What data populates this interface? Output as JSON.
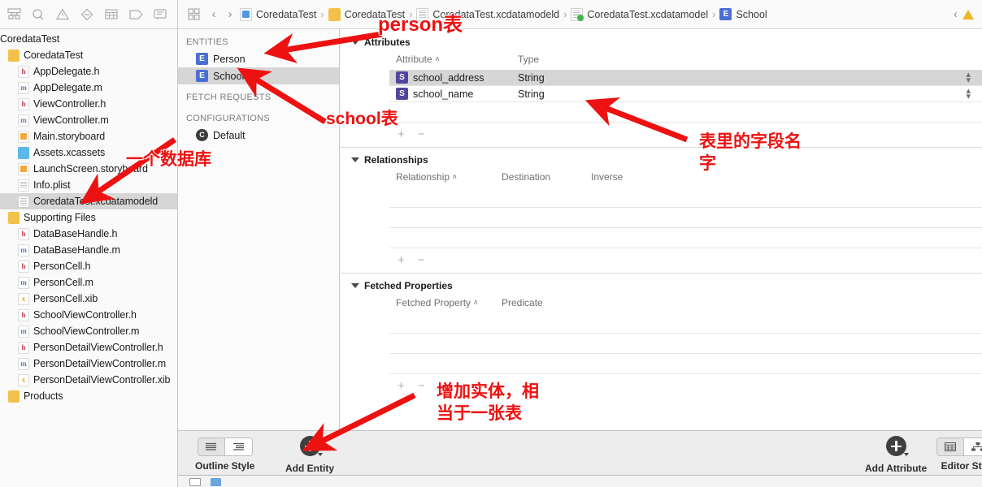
{
  "navigator": {
    "toolbar_icons": [
      "file-navigator-icon",
      "search-navigator-icon",
      "issue-navigator-icon",
      "test-navigator-icon",
      "debug-navigator-icon",
      "breakpoint-navigator-icon",
      "report-navigator-icon"
    ],
    "root": "CoredataTest",
    "items": [
      {
        "label": "CoredataTest",
        "kind": "folder",
        "level": 1
      },
      {
        "label": "AppDelegate.h",
        "kind": "h",
        "level": 2
      },
      {
        "label": "AppDelegate.m",
        "kind": "m",
        "level": 2
      },
      {
        "label": "ViewController.h",
        "kind": "h",
        "level": 2
      },
      {
        "label": "ViewController.m",
        "kind": "m",
        "level": 2
      },
      {
        "label": "Main.storyboard",
        "kind": "sb",
        "level": 2
      },
      {
        "label": "Assets.xcassets",
        "kind": "folder-blue",
        "level": 2
      },
      {
        "label": "LaunchScreen.storyboard",
        "kind": "sb",
        "level": 2
      },
      {
        "label": "Info.plist",
        "kind": "plist",
        "level": 2
      },
      {
        "label": "CoredataTest.xcdatamodeld",
        "kind": "model",
        "level": 2,
        "selected": true
      },
      {
        "label": "Supporting Files",
        "kind": "folder",
        "level": 1
      },
      {
        "label": "DataBaseHandle.h",
        "kind": "h",
        "level": 2
      },
      {
        "label": "DataBaseHandle.m",
        "kind": "m",
        "level": 2
      },
      {
        "label": "PersonCell.h",
        "kind": "h",
        "level": 2
      },
      {
        "label": "PersonCell.m",
        "kind": "m",
        "level": 2
      },
      {
        "label": "PersonCell.xib",
        "kind": "xib",
        "level": 2
      },
      {
        "label": "SchoolViewController.h",
        "kind": "h",
        "level": 2
      },
      {
        "label": "SchoolViewController.m",
        "kind": "m",
        "level": 2
      },
      {
        "label": "PersonDetailViewController.h",
        "kind": "h",
        "level": 2
      },
      {
        "label": "PersonDetailViewController.m",
        "kind": "m",
        "level": 2
      },
      {
        "label": "PersonDetailViewController.xib",
        "kind": "xib",
        "level": 2
      },
      {
        "label": "Products",
        "kind": "folder",
        "level": 1
      }
    ]
  },
  "jumpbar": {
    "back_label": "‹",
    "forward_label": "›",
    "crumbs": [
      {
        "label": "CoredataTest",
        "icon": "project-icon"
      },
      {
        "label": "CoredataTest",
        "icon": "folder-icon"
      },
      {
        "label": "CoredataTest.xcdatamodeld",
        "icon": "datamodeld-icon"
      },
      {
        "label": "CoredataTest.xcdatamodel",
        "icon": "datamodel-ok-icon"
      },
      {
        "label": "School",
        "icon": "entity-icon"
      }
    ],
    "separator": "›",
    "right_collapse": "‹"
  },
  "entity_sidebar": {
    "sections": [
      {
        "title": "ENTITIES",
        "items": [
          {
            "label": "Person",
            "badge": "E",
            "selected": false
          },
          {
            "label": "School",
            "badge": "E",
            "selected": true
          }
        ]
      },
      {
        "title": "FETCH REQUESTS",
        "items": []
      },
      {
        "title": "CONFIGURATIONS",
        "items": [
          {
            "label": "Default",
            "badge": "C",
            "selected": false
          }
        ]
      }
    ]
  },
  "editor": {
    "attributes": {
      "title": "Attributes",
      "columns": [
        "Attribute",
        "Type"
      ],
      "sort_indicator": "ʌ",
      "rows": [
        {
          "badge": "S",
          "name": "school_address",
          "type": "String",
          "selected": true
        },
        {
          "badge": "S",
          "name": "school_name",
          "type": "String",
          "selected": false
        }
      ],
      "add_label": "+",
      "remove_label": "−"
    },
    "relationships": {
      "title": "Relationships",
      "columns": [
        "Relationship",
        "Destination",
        "Inverse"
      ],
      "rows": [],
      "empty_rows": 3,
      "add_label": "+",
      "remove_label": "−"
    },
    "fetched_properties": {
      "title": "Fetched Properties",
      "columns": [
        "Fetched Property",
        "Predicate"
      ],
      "rows": [],
      "empty_rows": 3,
      "add_label": "+",
      "remove_label": "−"
    }
  },
  "bottom_bar": {
    "outline_style": {
      "label": "Outline Style",
      "options": [
        "list-style-icon",
        "hierarchy-style-icon"
      ],
      "selected_index": 1
    },
    "add_entity": {
      "label": "Add Entity",
      "icon": "plus-circle-icon"
    },
    "add_attribute": {
      "label": "Add Attribute",
      "icon": "plus-circle-icon"
    },
    "editor_style": {
      "label": "Editor Sty",
      "options": [
        "table-editor-icon",
        "graph-editor-icon"
      ],
      "selected_index": 1
    }
  },
  "annotations": [
    {
      "id": "person-table",
      "text": "person表"
    },
    {
      "id": "school-table",
      "text": "school表"
    },
    {
      "id": "one-database",
      "text": "一个数据库"
    },
    {
      "id": "field-names",
      "text": "表里的字段名\n字"
    },
    {
      "id": "add-entity-note",
      "text": "增加实体，相\n当于一张表"
    }
  ],
  "colors": {
    "annotation_red": "#ee1111",
    "entity_badge": "#4a6fd4",
    "attribute_badge": "#56449c",
    "selection_gray": "#d6d6d6"
  }
}
